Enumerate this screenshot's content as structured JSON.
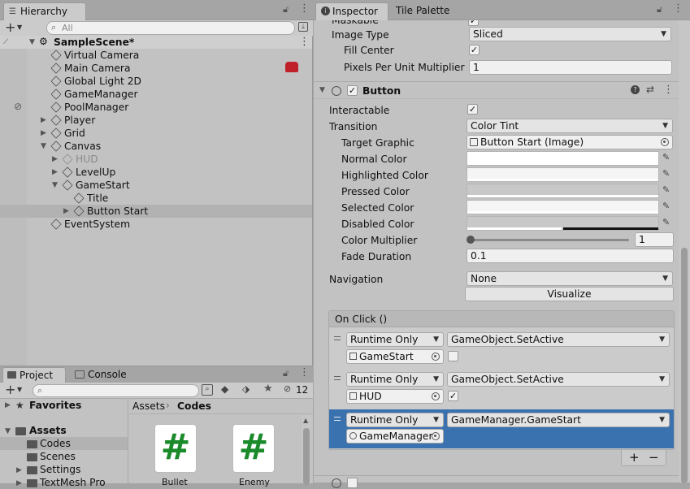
{
  "hierarchy": {
    "tab": "Hierarchy",
    "search_placeholder": "All",
    "scene": "SampleScene*",
    "items": [
      {
        "label": "Virtual Camera",
        "depth": 1,
        "arrow": "",
        "dim": false
      },
      {
        "label": "Main Camera",
        "depth": 1,
        "arrow": "",
        "dim": false
      },
      {
        "label": "Global Light 2D",
        "depth": 1,
        "arrow": "",
        "dim": false
      },
      {
        "label": "GameManager",
        "depth": 1,
        "arrow": "",
        "dim": false
      },
      {
        "label": "PoolManager",
        "depth": 1,
        "arrow": "",
        "dim": false
      },
      {
        "label": "Player",
        "depth": 1,
        "arrow": "right",
        "dim": false
      },
      {
        "label": "Grid",
        "depth": 1,
        "arrow": "right",
        "dim": false
      },
      {
        "label": "Canvas",
        "depth": 1,
        "arrow": "down",
        "dim": false
      },
      {
        "label": "HUD",
        "depth": 2,
        "arrow": "right",
        "dim": true
      },
      {
        "label": "LevelUp",
        "depth": 2,
        "arrow": "right",
        "dim": false
      },
      {
        "label": "GameStart",
        "depth": 2,
        "arrow": "down",
        "dim": false
      },
      {
        "label": "Title",
        "depth": 3,
        "arrow": "",
        "dim": false
      },
      {
        "label": "Button Start",
        "depth": 3,
        "arrow": "right",
        "dim": false
      },
      {
        "label": "EventSystem",
        "depth": 1,
        "arrow": "",
        "dim": false
      }
    ]
  },
  "project": {
    "tabs": [
      "Project",
      "Console"
    ],
    "badge": "12",
    "tree": [
      "Favorites",
      "Assets",
      "Codes",
      "Scenes",
      "Settings",
      "TextMesh Pro"
    ],
    "breadcrumb": [
      "Assets",
      "Codes"
    ],
    "files": [
      "Bullet",
      "Enemy"
    ]
  },
  "inspector": {
    "tabs": [
      "Inspector",
      "Tile Palette"
    ],
    "top": {
      "maskable": "Maskable",
      "image_type_label": "Image Type",
      "image_type": "Sliced",
      "fill_center_label": "Fill Center",
      "ppu_label": "Pixels Per Unit Multiplier",
      "ppu": "1"
    },
    "button": {
      "title": "Button",
      "interactable": "Interactable",
      "transition_label": "Transition",
      "transition": "Color Tint",
      "target_graphic_label": "Target Graphic",
      "target_graphic": "Button Start (Image)",
      "normal_color": "Normal Color",
      "highlighted_color": "Highlighted Color",
      "pressed_color": "Pressed Color",
      "selected_color": "Selected Color",
      "disabled_color": "Disabled Color",
      "color_multiplier_label": "Color Multiplier",
      "color_multiplier": "1",
      "color_multiplier_level": 0,
      "fade_duration_label": "Fade Duration",
      "fade_duration": "0.1",
      "navigation_label": "Navigation",
      "navigation": "None",
      "visualize": "Visualize"
    },
    "onclick": {
      "title": "On Click ()",
      "entries": [
        {
          "mode": "Runtime Only",
          "function": "GameObject.SetActive",
          "target": "GameStart",
          "checked": false
        },
        {
          "mode": "Runtime Only",
          "function": "GameObject.SetActive",
          "target": "HUD",
          "checked": true
        },
        {
          "mode": "Runtime Only",
          "function": "GameManager.GameStart",
          "target": "GameManager",
          "checked": null
        }
      ],
      "add": "+",
      "remove": "−"
    }
  },
  "colors": {
    "selection_blue": "#3a72b0",
    "panel": "#c2c2c2",
    "row_highlight": "#b2b2b2"
  }
}
